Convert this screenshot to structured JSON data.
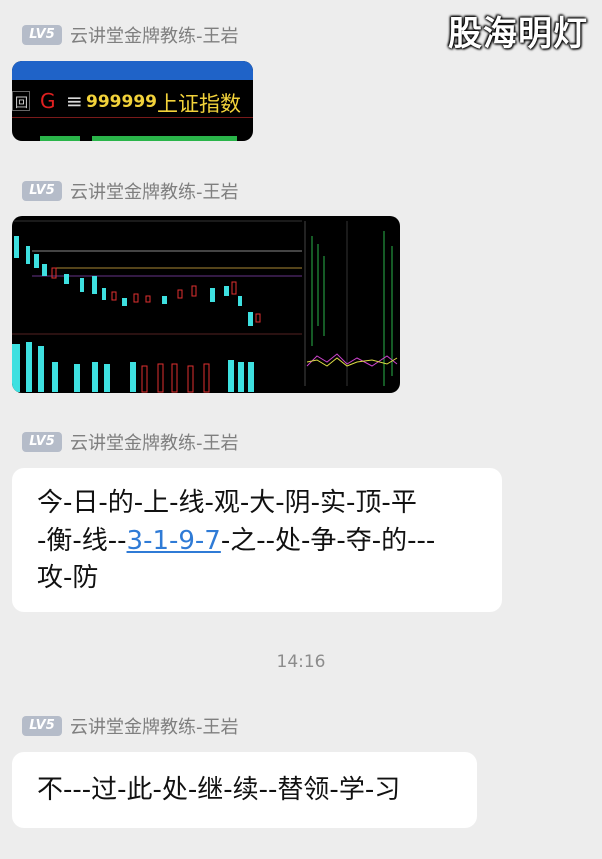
{
  "watermark": {
    "text": "股海明灯"
  },
  "colors": {
    "background": "#ededed",
    "bubble": "#ffffff",
    "link": "#2f7bd6",
    "badge": "#b5bcc9"
  },
  "messages": [
    {
      "sender": {
        "level": "LV5",
        "name": "云讲堂金牌教练-王岩"
      },
      "image": {
        "kind": "index-header",
        "menu_icon": "回",
        "g_label": "G",
        "equal_icon": "≡",
        "index_code": "999999",
        "index_name": "上证指数"
      }
    },
    {
      "sender": {
        "level": "LV5",
        "name": "云讲堂金牌教练-王岩"
      },
      "image": {
        "kind": "kline-chart-thumbnail"
      }
    },
    {
      "sender": {
        "level": "LV5",
        "name": "云讲堂金牌教练-王岩"
      },
      "text": {
        "line1": "今-日-的-上-线-观-大-阴-实-顶-平",
        "line2_pre": "-衡-线--",
        "line2_link": "3-1-9-7",
        "line2_post": "-之--处-争-夺-的---",
        "line3": "攻-防"
      }
    },
    {
      "sender": {
        "level": "LV5",
        "name": "云讲堂金牌教练-王岩"
      },
      "text": {
        "line1": "不---过-此-处-继-续--替领-学-习"
      }
    }
  ],
  "timestamp": "14:16"
}
